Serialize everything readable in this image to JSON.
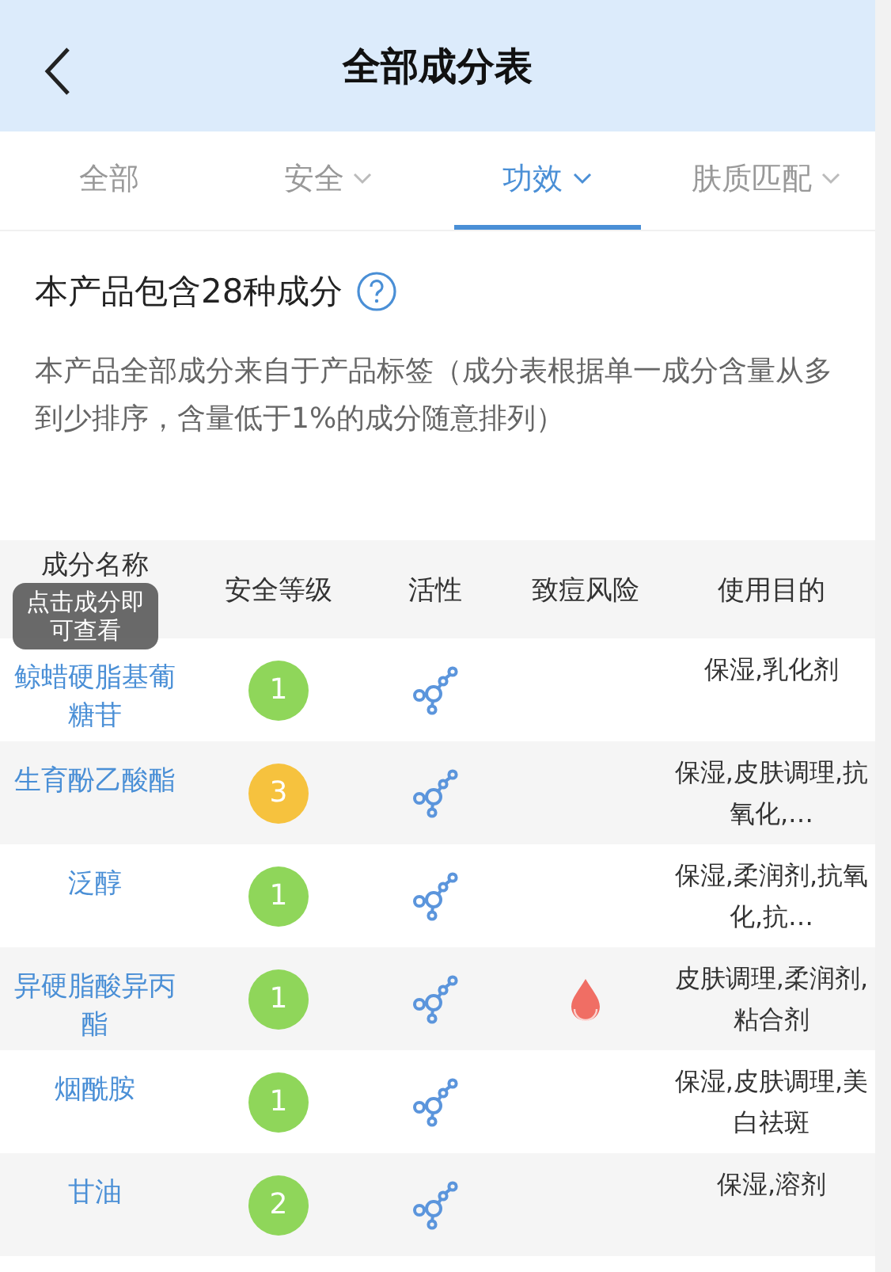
{
  "header": {
    "title": "全部成分表"
  },
  "tabs": [
    {
      "label": "全部",
      "dropdown": false,
      "selected": false
    },
    {
      "label": "安全",
      "dropdown": true,
      "selected": false
    },
    {
      "label": "功效",
      "dropdown": true,
      "selected": true
    },
    {
      "label": "肤质匹配",
      "dropdown": true,
      "selected": false
    }
  ],
  "summary": {
    "title": "本产品包含28种成分",
    "description": "本产品全部成分来自于产品标签（成分表根据单一成分含量从多到少排序，含量低于1%的成分随意排列）"
  },
  "table": {
    "columns": [
      "成分名称",
      "安全等级",
      "活性",
      "致痘风险",
      "使用目的"
    ],
    "tooltip": "点击成分即可查看",
    "rows": [
      {
        "name": "鲸蜡硬脂基葡糖苷",
        "safety": "1",
        "color": "#8fd65a",
        "active": true,
        "acne_risk": false,
        "purpose": "保湿,乳化剂"
      },
      {
        "name": "生育酚乙酸酯",
        "safety": "3",
        "color": "#f6c23e",
        "active": true,
        "acne_risk": false,
        "purpose": "保湿,皮肤调理,抗氧化,…"
      },
      {
        "name": "泛醇",
        "safety": "1",
        "color": "#8fd65a",
        "active": true,
        "acne_risk": false,
        "purpose": "保湿,柔润剂,抗氧化,抗…"
      },
      {
        "name": "异硬脂酸异丙酯",
        "safety": "1",
        "color": "#8fd65a",
        "active": true,
        "acne_risk": true,
        "purpose": "皮肤调理,柔润剂,粘合剂"
      },
      {
        "name": "烟酰胺",
        "safety": "1",
        "color": "#8fd65a",
        "active": true,
        "acne_risk": false,
        "purpose": "保湿,皮肤调理,美白祛斑"
      },
      {
        "name": "甘油",
        "safety": "2",
        "color": "#8fd65a",
        "active": true,
        "acne_risk": false,
        "purpose": "保湿,溶剂"
      }
    ]
  }
}
